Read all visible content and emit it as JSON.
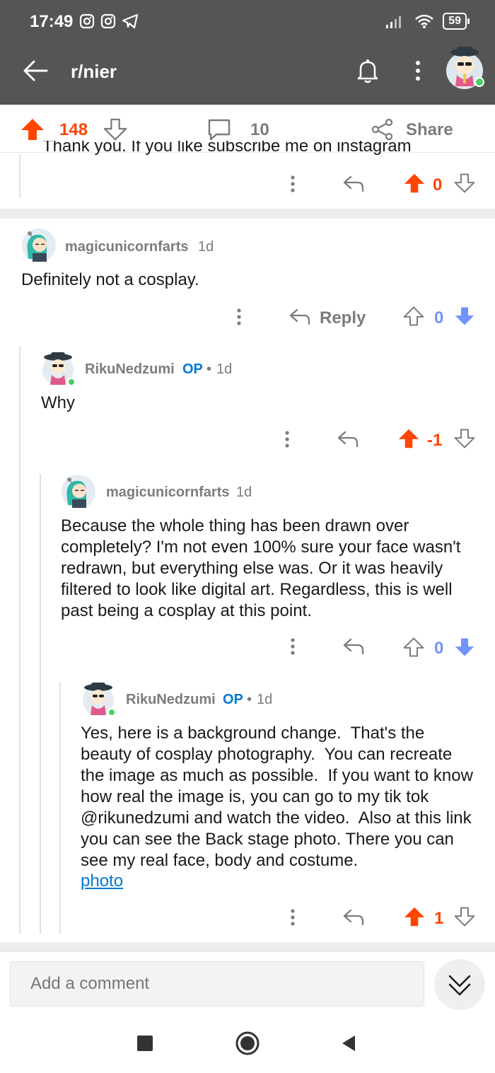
{
  "status": {
    "time": "17:49",
    "battery": "59"
  },
  "header": {
    "title": "r/nier"
  },
  "post_bar": {
    "score": "148",
    "comments": "10",
    "share_label": "Share"
  },
  "cutoff_text": "Thank you. If you like subscribe me on instagram",
  "cutoff_actions": {
    "vote": "0"
  },
  "comments": [
    {
      "user": "magicunicornfarts",
      "op": "",
      "age": "1d",
      "text": "Definitely not a cosplay.",
      "reply_label": "Reply",
      "vote": "0"
    },
    {
      "user": "RikuNedzumi",
      "op": "OP",
      "sep": "•",
      "age": "1d",
      "text": "Why",
      "vote": "-1"
    },
    {
      "user": "magicunicornfarts",
      "op": "",
      "age": "1d",
      "text": "Because the whole thing has been drawn over completely? I'm not even 100% sure your face wasn't redrawn, but everything else was. Or it was heavily filtered to look like digital art. Regardless, this is well past being a cosplay at this point.",
      "vote": "0"
    },
    {
      "user": "RikuNedzumi",
      "op": "OP",
      "sep": "•",
      "age": "1d",
      "text": "Yes, here is a background change.  That's the beauty of cosplay photography.  You can recreate the image as much as possible.  If you want to know how real the image is, you can go to my tik tok @rikunedzumi and watch the video.  Also at this link you can see the Back stage photo. There you can see my real face, body and costume.",
      "link": "photo",
      "vote": "1"
    }
  ],
  "composer": {
    "placeholder": "Add a comment"
  },
  "colors": {
    "upvote": "#ff4500",
    "downvote": "#7193ff",
    "op": "#0079d3",
    "muted": "#7c7c7c"
  }
}
